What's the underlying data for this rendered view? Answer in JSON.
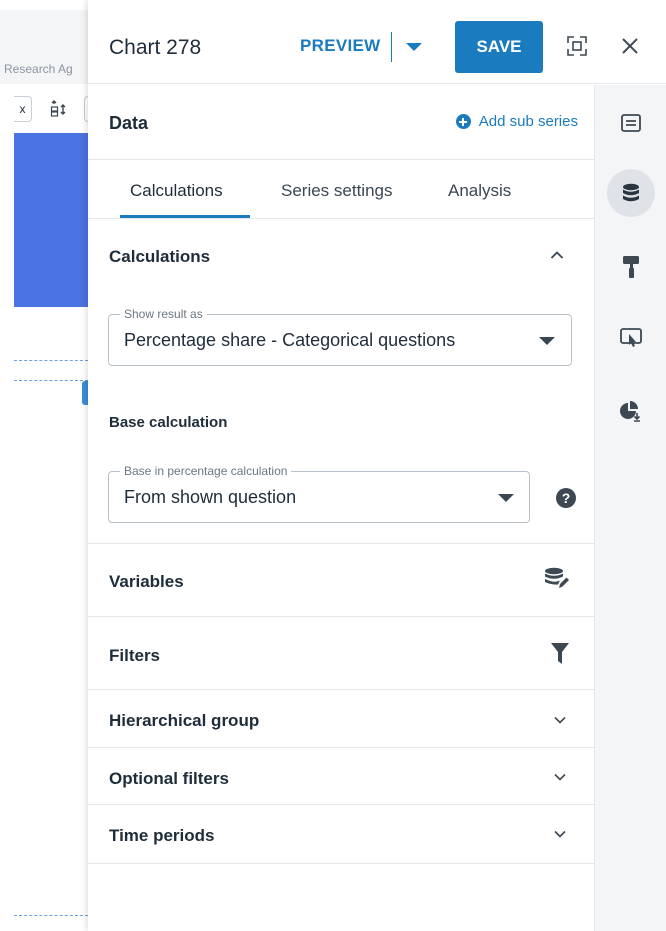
{
  "background": {
    "breadcrumb": "Research Ag",
    "toolbar_box": "x"
  },
  "header": {
    "title": "Chart 278",
    "preview_label": "PREVIEW",
    "save_label": "SAVE"
  },
  "data_section": {
    "title": "Data",
    "add_sub_series": "Add sub series"
  },
  "tabs": [
    {
      "label": "Calculations",
      "active": true
    },
    {
      "label": "Series settings",
      "active": false
    },
    {
      "label": "Analysis",
      "active": false
    }
  ],
  "calculations": {
    "header": "Calculations",
    "show_result_as": {
      "legend": "Show result as",
      "value": "Percentage share - Categorical questions"
    },
    "base_calculation_label": "Base calculation",
    "base_in_percentage": {
      "legend": "Base in percentage calculation",
      "value": "From shown question"
    },
    "help_glyph": "?"
  },
  "sections": [
    {
      "title": "Variables",
      "icon": "database-edit-icon"
    },
    {
      "title": "Filters",
      "icon": "filter-icon"
    },
    {
      "title": "Hierarchical group",
      "icon": "chevron-down-icon"
    },
    {
      "title": "Optional filters",
      "icon": "chevron-down-icon"
    },
    {
      "title": "Time periods",
      "icon": "chevron-down-icon"
    }
  ],
  "rail": [
    {
      "icon": "text-box-icon",
      "active": false
    },
    {
      "icon": "database-icon",
      "active": true
    },
    {
      "icon": "paint-roller-icon",
      "active": false
    },
    {
      "icon": "interactive-screen-icon",
      "active": false
    },
    {
      "icon": "pie-download-icon",
      "active": false
    }
  ],
  "colors": {
    "accent": "#1a7bbf",
    "chart_fill": "#4a72e0",
    "text": "#1f2d3a",
    "rail_bg": "#f4f5f7"
  }
}
